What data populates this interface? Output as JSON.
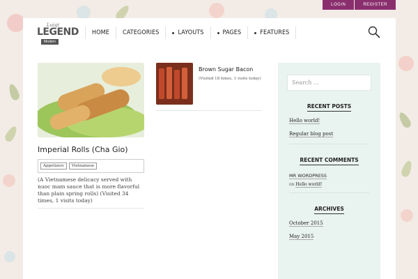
{
  "topbar": {
    "login": "LOGIN",
    "register": "REGISTER"
  },
  "logo": {
    "script": "Luigi",
    "word": "LEGEND",
    "tag": "Modern"
  },
  "nav": [
    {
      "label": "HOME",
      "dot": false
    },
    {
      "label": "CATEGORIES",
      "dot": false
    },
    {
      "label": "LAYOUTS",
      "dot": true
    },
    {
      "label": "PAGES",
      "dot": true
    },
    {
      "label": "FEATURES",
      "dot": true
    }
  ],
  "post": {
    "title": "Imperial Rolls (Cha Gio)",
    "tags": [
      "Appetizers",
      "Vietnamese"
    ],
    "description": "(A Vietnamese delicacy served with nuoc mam sauce that is more flavorful than plain spring rolls) (Visited 34 times, 1 visits today)"
  },
  "side_post": {
    "title": "Brown Sugar Bacon",
    "meta": "(Visited 18 times, 1 visits today)"
  },
  "sidebar": {
    "search_placeholder": "Search ...",
    "recent_posts_title": "RECENT POSTS",
    "recent_posts": [
      "Hello world!",
      "Regular blog post"
    ],
    "recent_comments_title": "RECENT COMMENTS",
    "comment_author": "MR WORDPRESS",
    "comment_on": "on",
    "comment_post": "Hello world!",
    "archives_title": "ARCHIVES",
    "archives": [
      "October 2015",
      "May 2015"
    ]
  },
  "colors": {
    "accent": "#8a2f6e",
    "sidebar_bg": "#e9f3f0",
    "page_bg": "#f3ece6"
  }
}
